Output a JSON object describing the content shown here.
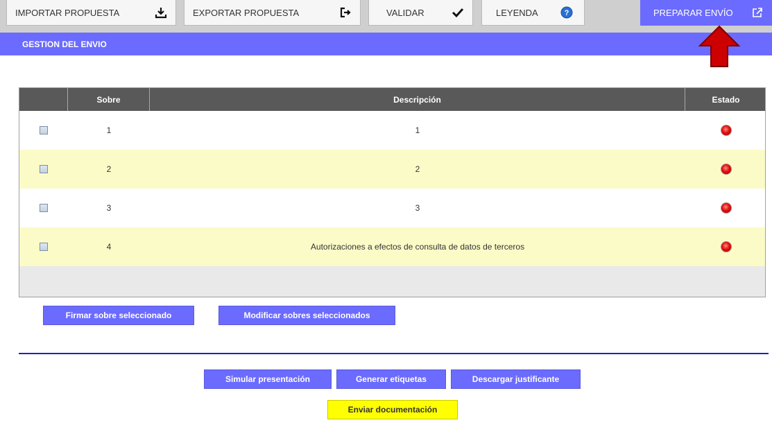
{
  "toolbar": {
    "items": [
      {
        "label": "IMPORTAR PROPUESTA",
        "icon": "download-icon",
        "glyph": "⤓"
      },
      {
        "label": "EXPORTAR PROPUESTA",
        "icon": "export-icon",
        "glyph": "⇥"
      },
      {
        "label": "VALIDAR",
        "icon": "check-icon",
        "glyph": "✔"
      },
      {
        "label": "LEYENDA",
        "icon": "help-icon",
        "glyph": "?"
      },
      {
        "label": "PREPARAR ENVÍO",
        "icon": "share-icon",
        "glyph": "⇗"
      }
    ],
    "active_item": "PREPARAR ENVÍO",
    "active_color": "#6b6bff"
  },
  "section": {
    "title": "GESTION DEL ENVIO"
  },
  "table": {
    "headers": [
      "",
      "Sobre",
      "Descripción",
      "Estado"
    ],
    "rows": [
      {
        "sobre": "1",
        "descripcion": "1",
        "estado": "red-status-icon",
        "checked": false
      },
      {
        "sobre": "2",
        "descripcion": "2",
        "estado": "red-status-icon",
        "checked": false
      },
      {
        "sobre": "3",
        "descripcion": "3",
        "estado": "red-status-icon",
        "checked": false
      },
      {
        "sobre": "4",
        "descripcion": "Autorizaciones a efectos de consulta de datos de terceros",
        "estado": "red-status-icon",
        "checked": false
      }
    ]
  },
  "actions": {
    "firmar": "Firmar sobre seleccionado",
    "modificar": "Modificar sobres seleccionados",
    "simular": "Simular presentación",
    "generar": "Generar etiquetas",
    "descargar": "Descargar justificante",
    "enviar": "Enviar documentación"
  },
  "colors": {
    "accent": "#6b6bff",
    "row_alt": "#fbfbc8",
    "header": "#595959",
    "send_button": "#ffff00",
    "arrow": "#cc0000"
  }
}
